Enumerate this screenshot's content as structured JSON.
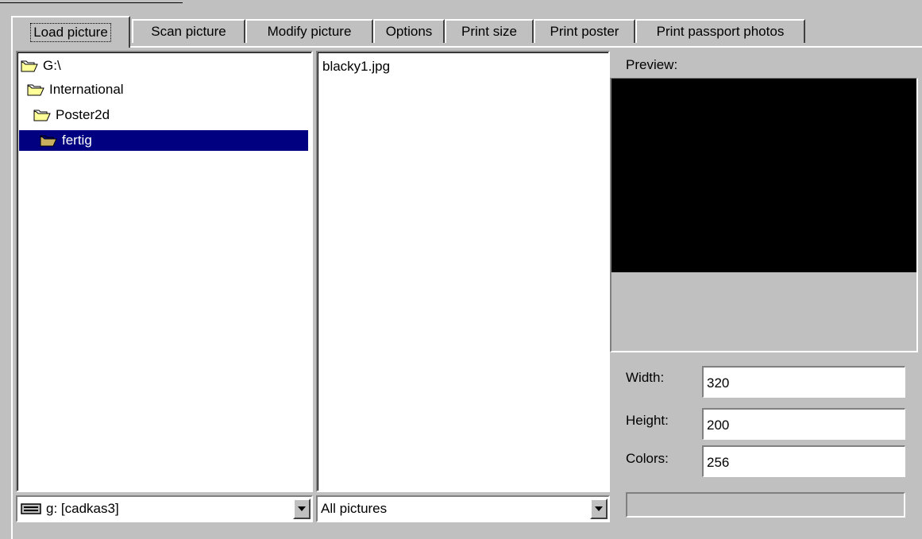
{
  "tabs": [
    {
      "label": "Load picture",
      "active": true
    },
    {
      "label": "Scan picture",
      "active": false
    },
    {
      "label": "Modify picture",
      "active": false
    },
    {
      "label": "Options",
      "active": false
    },
    {
      "label": "Print size",
      "active": false
    },
    {
      "label": "Print poster",
      "active": false
    },
    {
      "label": "Print passport photos",
      "active": false
    }
  ],
  "folder_tree": [
    {
      "label": "G:\\",
      "icon": "open-folder-icon",
      "selected": false
    },
    {
      "label": "International",
      "icon": "open-folder-icon",
      "selected": false
    },
    {
      "label": "Poster2d",
      "icon": "open-folder-icon",
      "selected": false
    },
    {
      "label": "fertig",
      "icon": "open-folder-icon",
      "selected": true
    }
  ],
  "files": [
    "blacky1.jpg"
  ],
  "preview": {
    "label": "Preview:",
    "width_label": "Width:",
    "width_value": "320",
    "height_label": "Height:",
    "height_value": "200",
    "colors_label": "Colors:",
    "colors_value": "256"
  },
  "drive_select": {
    "value": "g: [cadkas3]",
    "icon": "drive-icon"
  },
  "filter_select": {
    "value": "All pictures"
  },
  "progress": {
    "value": 0
  },
  "colors": {
    "selection": "#000080",
    "face": "#c0c0c0",
    "preview_bg": "#000000"
  }
}
